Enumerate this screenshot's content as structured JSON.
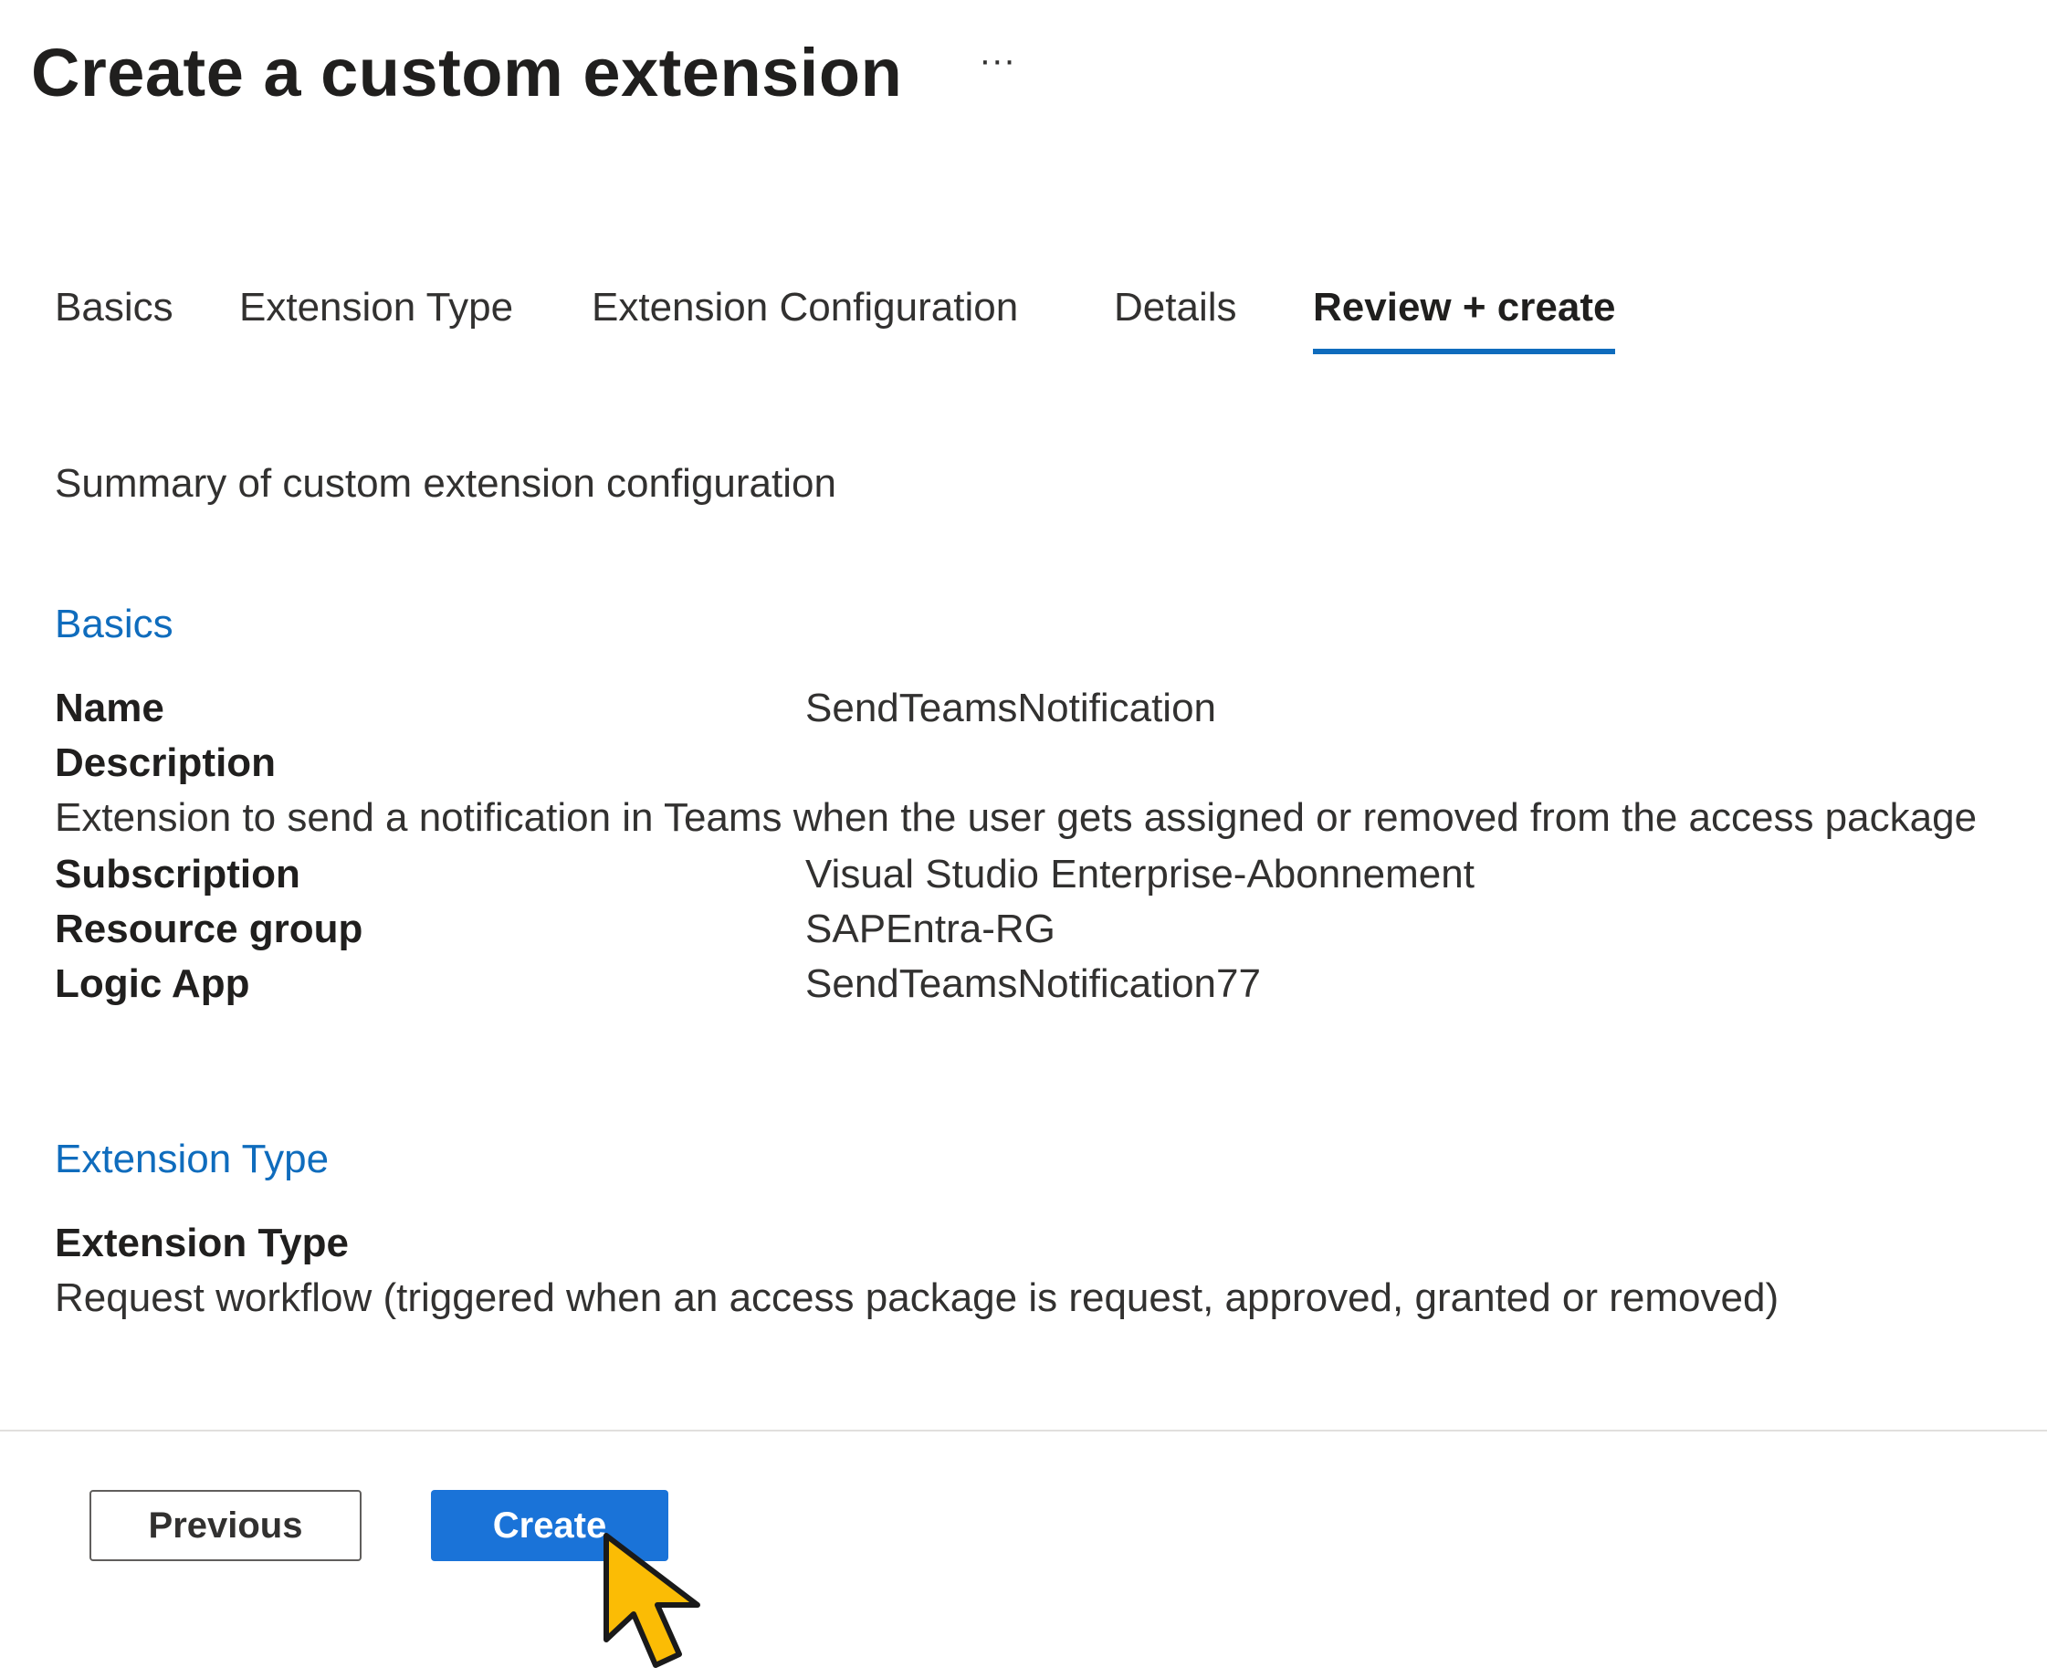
{
  "header": {
    "title": "Create a custom extension",
    "more_label": "···"
  },
  "tabs": [
    {
      "label": "Basics",
      "active": false
    },
    {
      "label": "Extension Type",
      "active": false
    },
    {
      "label": "Extension Configuration",
      "active": false
    },
    {
      "label": "Details",
      "active": false
    },
    {
      "label": "Review + create",
      "active": true
    }
  ],
  "summary_text": "Summary of custom extension configuration",
  "basics": {
    "heading": "Basics",
    "name_label": "Name",
    "name_value": "SendTeamsNotification",
    "description_label": "Description",
    "description_value": "Extension to send a notification in Teams when the user gets assigned or removed from the access package",
    "subscription_label": "Subscription",
    "subscription_value": "Visual Studio Enterprise-Abonnement",
    "resource_group_label": "Resource group",
    "resource_group_value": "SAPEntra-RG",
    "logic_app_label": "Logic App",
    "logic_app_value": "SendTeamsNotification77"
  },
  "extension_type": {
    "heading": "Extension Type",
    "type_label": "Extension Type",
    "type_value": "Request workflow (triggered when an access package is request, approved, granted or removed)"
  },
  "footer": {
    "previous_label": "Previous",
    "create_label": "Create"
  },
  "colors": {
    "accent": "#0f6cbd",
    "primary_button": "#1a73d8",
    "cursor_fill": "#fbbc05"
  }
}
